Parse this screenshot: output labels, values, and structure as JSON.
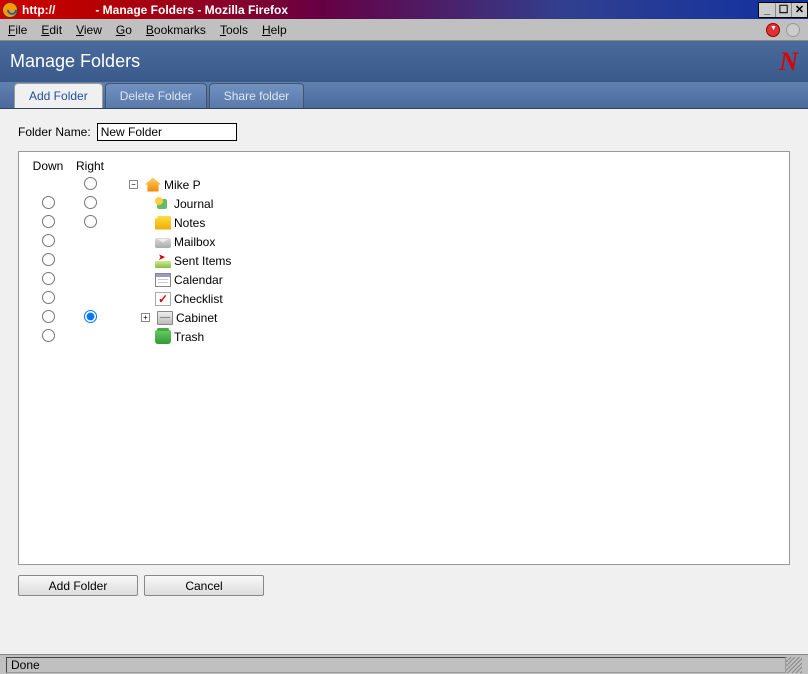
{
  "window": {
    "url_prefix": "http://",
    "title": "- Manage Folders - Mozilla Firefox"
  },
  "menus": {
    "file": "File",
    "edit": "Edit",
    "view": "View",
    "go": "Go",
    "bookmarks": "Bookmarks",
    "tools": "Tools",
    "help": "Help"
  },
  "header": {
    "title": "Manage Folders"
  },
  "tabs": {
    "add": "Add Folder",
    "delete": "Delete Folder",
    "share": "Share folder"
  },
  "form": {
    "folder_name_label": "Folder Name:",
    "folder_name_value": "New Folder"
  },
  "columns": {
    "down": "Down",
    "right": "Right"
  },
  "tree": {
    "root": {
      "label": "Mike P",
      "expanded": true
    },
    "items": [
      {
        "label": "Journal",
        "icon": "journal"
      },
      {
        "label": "Notes",
        "icon": "notes"
      },
      {
        "label": "Mailbox",
        "icon": "mailbox"
      },
      {
        "label": "Sent Items",
        "icon": "sent"
      },
      {
        "label": "Calendar",
        "icon": "calendar"
      },
      {
        "label": "Checklist",
        "icon": "checklist"
      },
      {
        "label": "Cabinet",
        "icon": "cabinet",
        "expandable": true,
        "right_selected": true
      },
      {
        "label": "Trash",
        "icon": "trash"
      }
    ]
  },
  "buttons": {
    "add": "Add Folder",
    "cancel": "Cancel"
  },
  "status": {
    "text": "Done"
  }
}
